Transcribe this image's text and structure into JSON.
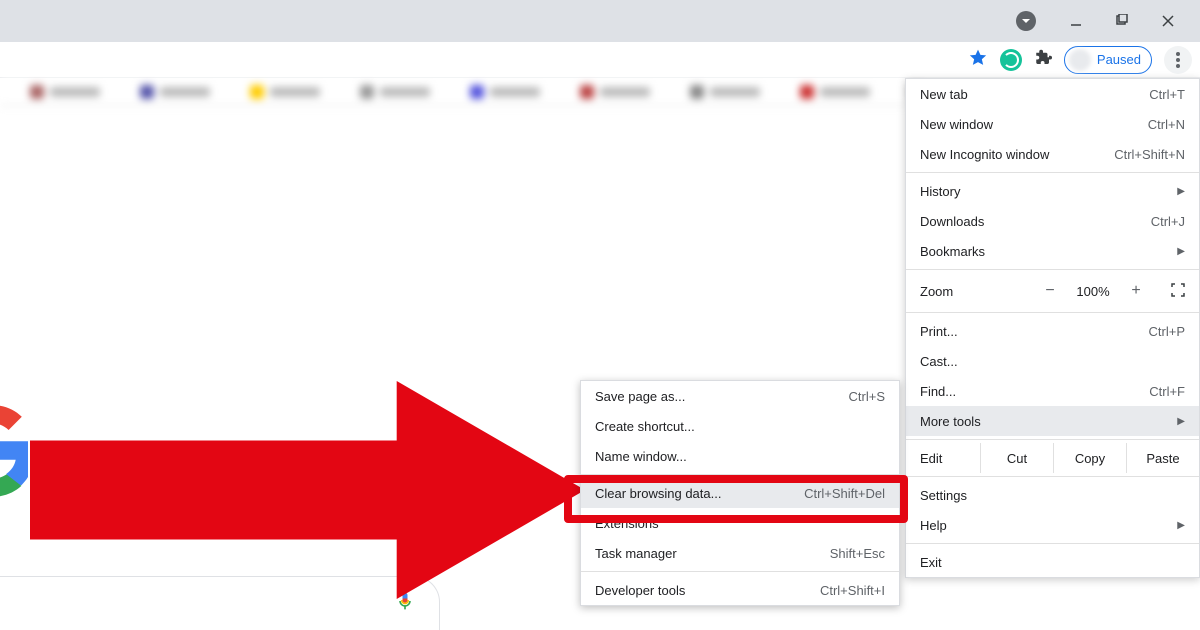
{
  "profile_label": "Paused",
  "main_menu": {
    "new_tab": "New tab",
    "new_tab_sc": "Ctrl+T",
    "new_window": "New window",
    "new_window_sc": "Ctrl+N",
    "incognito": "New Incognito window",
    "incognito_sc": "Ctrl+Shift+N",
    "history": "History",
    "downloads": "Downloads",
    "downloads_sc": "Ctrl+J",
    "bookmarks": "Bookmarks",
    "zoom_label": "Zoom",
    "zoom_value": "100%",
    "print": "Print...",
    "print_sc": "Ctrl+P",
    "cast": "Cast...",
    "find": "Find...",
    "find_sc": "Ctrl+F",
    "more_tools": "More tools",
    "edit_label": "Edit",
    "cut": "Cut",
    "copy": "Copy",
    "paste": "Paste",
    "settings": "Settings",
    "help": "Help",
    "exit": "Exit"
  },
  "sub_menu": {
    "save_page": "Save page as...",
    "save_page_sc": "Ctrl+S",
    "create_shortcut": "Create shortcut...",
    "name_window": "Name window...",
    "clear_data": "Clear browsing data...",
    "clear_data_sc": "Ctrl+Shift+Del",
    "extensions": "Extensions",
    "task_manager": "Task manager",
    "task_manager_sc": "Shift+Esc",
    "dev_tools": "Developer tools",
    "dev_tools_sc": "Ctrl+Shift+I"
  }
}
